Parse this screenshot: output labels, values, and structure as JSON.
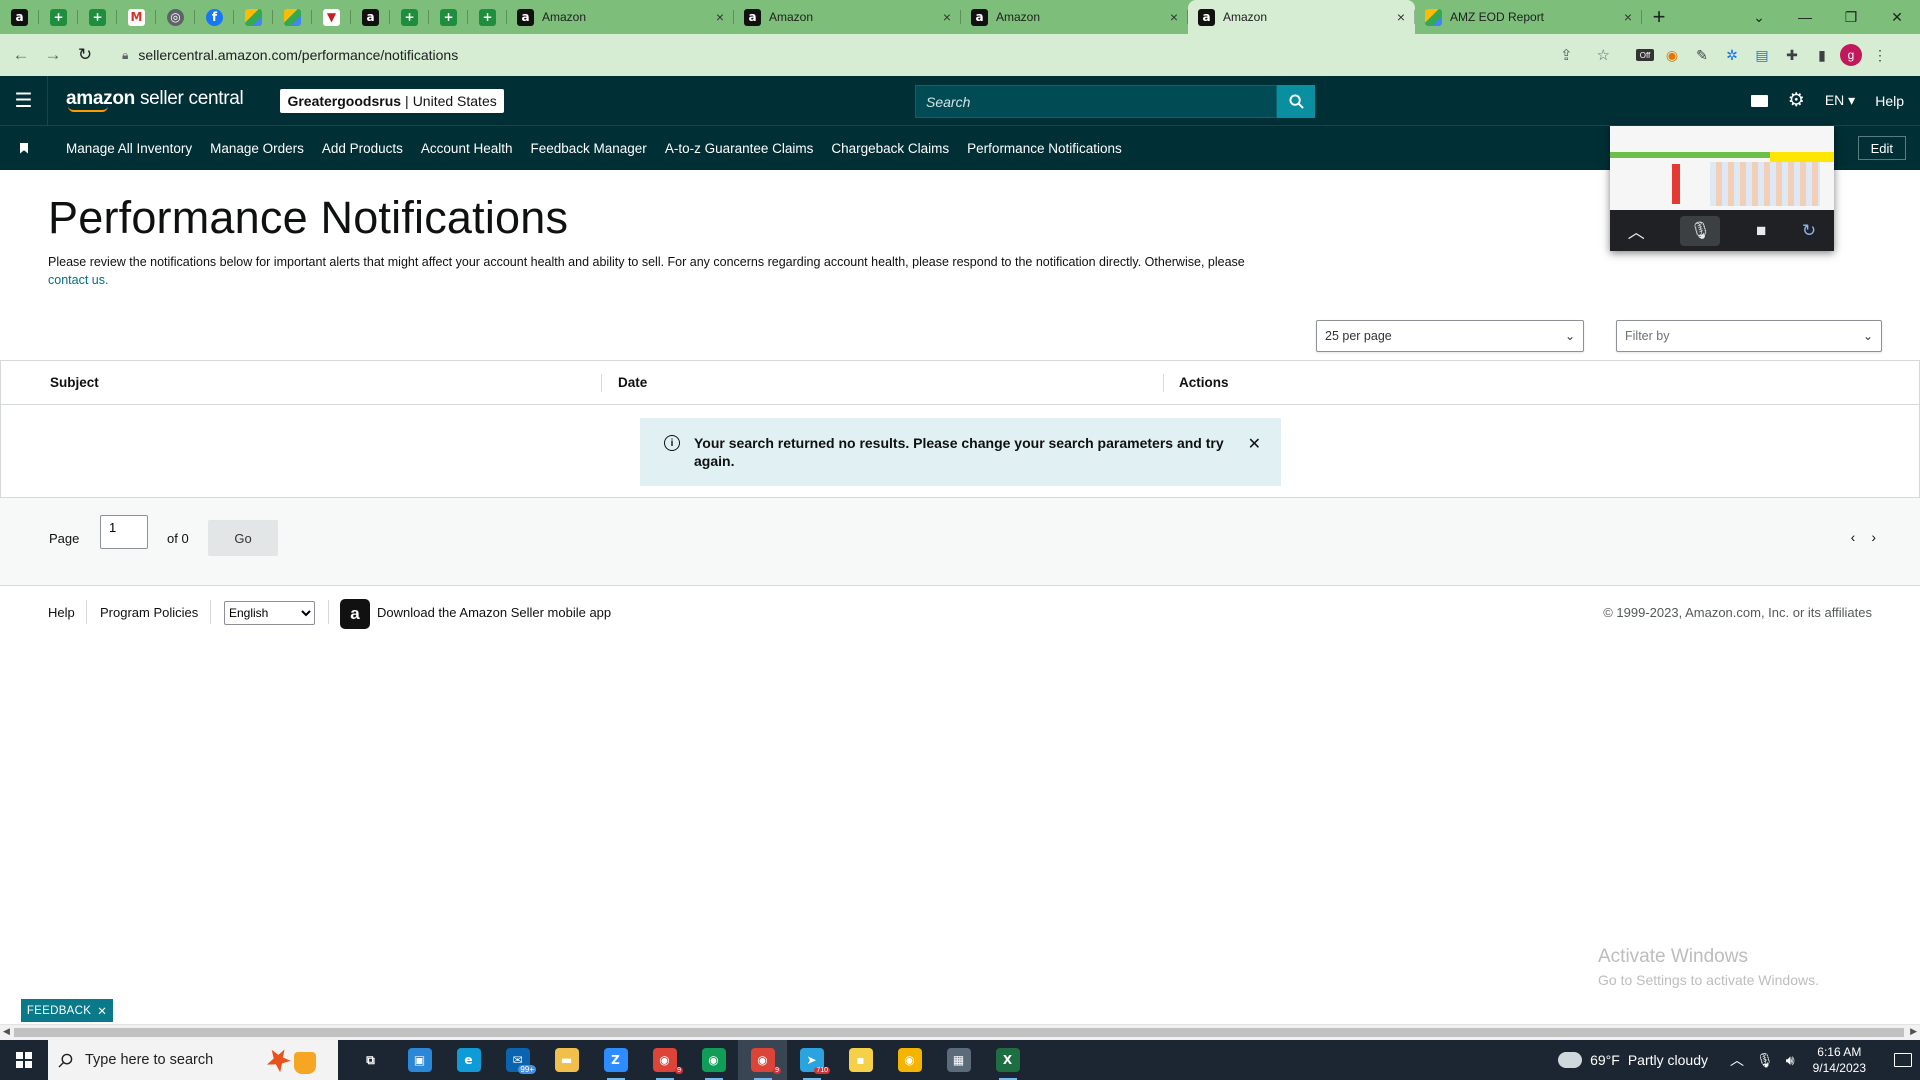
{
  "browser": {
    "pinned_tabs": [
      {
        "icon": "amazon-icon",
        "glyph": "a",
        "kind": "amz"
      },
      {
        "icon": "sheets-icon",
        "glyph": "+",
        "kind": "sheet"
      },
      {
        "icon": "sheets-icon",
        "glyph": "+",
        "kind": "sheet"
      },
      {
        "icon": "gmail-icon",
        "glyph": "M",
        "kind": "gmail"
      },
      {
        "icon": "globe-icon",
        "glyph": "◎",
        "kind": "gray"
      },
      {
        "icon": "facebook-icon",
        "glyph": "f",
        "kind": "fb"
      },
      {
        "icon": "drive-icon",
        "glyph": "",
        "kind": "drive"
      },
      {
        "icon": "drive-icon",
        "glyph": "",
        "kind": "drive"
      },
      {
        "icon": "tab-icon",
        "glyph": "▼",
        "kind": "red"
      },
      {
        "icon": "amazon-icon",
        "glyph": "a",
        "kind": "amz"
      },
      {
        "icon": "sheets-icon",
        "glyph": "+",
        "kind": "sheet"
      },
      {
        "icon": "sheets-icon",
        "glyph": "+",
        "kind": "sheet"
      },
      {
        "icon": "sheets-icon",
        "glyph": "+",
        "kind": "sheet"
      }
    ],
    "tabs": [
      {
        "title": "Amazon",
        "icon": "amazon-icon",
        "active": false
      },
      {
        "title": "Amazon",
        "icon": "amazon-icon",
        "active": false
      },
      {
        "title": "Amazon",
        "icon": "amazon-icon",
        "active": false
      },
      {
        "title": "Amazon",
        "icon": "amazon-icon",
        "active": true
      },
      {
        "title": "AMZ EOD Report",
        "icon": "report-icon",
        "active": false
      }
    ],
    "url": "sellercentral.amazon.com/performance/notifications",
    "profile_initial": "g",
    "extension_badge": "Off"
  },
  "header": {
    "logo_text_bold": "amazon",
    "logo_text": "seller central",
    "store_name": "Greatergoodsrus",
    "store_region": "United States",
    "search_placeholder": "Search",
    "language": "EN",
    "help_label": "Help"
  },
  "nav": {
    "links": [
      "Manage All Inventory",
      "Manage Orders",
      "Add Products",
      "Account Health",
      "Feedback Manager",
      "A-to-z Guarantee Claims",
      "Chargeback Claims",
      "Performance Notifications"
    ],
    "edit_label": "Edit"
  },
  "main": {
    "title": "Performance Notifications",
    "intro": "Please review the notifications below for important alerts that might affect your account health and ability to sell. For any concerns regarding account health, please respond to the notification directly. Otherwise, please",
    "contact_link": "contact us.",
    "per_page": "25 per page",
    "filter_placeholder": "Filter by",
    "columns": [
      "Subject",
      "Date",
      "Actions"
    ],
    "empty_message": "Your search returned no results. Please change your search parameters and try again.",
    "pager": {
      "page_label": "Page",
      "page_value": "1",
      "of_label": "of 0",
      "go_label": "Go"
    }
  },
  "footer": {
    "help": "Help",
    "policies": "Program Policies",
    "language": "English",
    "app_text": "Download the Amazon Seller mobile app",
    "copyright": "© 1999-2023, Amazon.com, Inc. or its affiliates"
  },
  "watermark": {
    "line1": "Activate Windows",
    "line2": "Go to Settings to activate Windows."
  },
  "feedback_label": "FEEDBACK",
  "taskbar": {
    "search_placeholder": "Type here to search",
    "weather_temp": "69°F",
    "weather_desc": "Partly cloudy",
    "time": "6:16 AM",
    "date": "9/14/2023",
    "apps": [
      {
        "name": "task-view-icon",
        "color": "#1c2633",
        "glyph": "⧉",
        "open": false,
        "badge": ""
      },
      {
        "name": "store-icon",
        "color": "#2b88d8",
        "glyph": "▣",
        "open": false,
        "badge": ""
      },
      {
        "name": "edge-icon",
        "color": "#0f9bd7",
        "glyph": "e",
        "open": false,
        "badge": ""
      },
      {
        "name": "mail-icon",
        "color": "#0a64b0",
        "glyph": "✉",
        "open": false,
        "badge": "99+"
      },
      {
        "name": "file-explorer-icon",
        "color": "#f0c04a",
        "glyph": "▬",
        "open": false,
        "badge": ""
      },
      {
        "name": "zoom-icon",
        "color": "#2d8cff",
        "glyph": "Z",
        "open": true,
        "badge": ""
      },
      {
        "name": "chrome-icon",
        "color": "#db4437",
        "glyph": "◉",
        "open": true,
        "badge": "9"
      },
      {
        "name": "chrome-icon",
        "color": "#0f9d58",
        "glyph": "◉",
        "open": true,
        "badge": ""
      },
      {
        "name": "chrome-icon",
        "color": "#db4437",
        "glyph": "◉",
        "open": true,
        "badge": "9",
        "active": true
      },
      {
        "name": "telegram-icon",
        "color": "#2aa3df",
        "glyph": "➤",
        "open": true,
        "badge": "710"
      },
      {
        "name": "sticky-notes-icon",
        "color": "#f7d04a",
        "glyph": "▪",
        "open": false,
        "badge": ""
      },
      {
        "name": "chrome-icon",
        "color": "#f4b400",
        "glyph": "◉",
        "open": false,
        "badge": ""
      },
      {
        "name": "calculator-icon",
        "color": "#5c6b7a",
        "glyph": "▦",
        "open": false,
        "badge": ""
      },
      {
        "name": "excel-icon",
        "color": "#1d6f42",
        "glyph": "X",
        "open": true,
        "badge": ""
      }
    ]
  }
}
